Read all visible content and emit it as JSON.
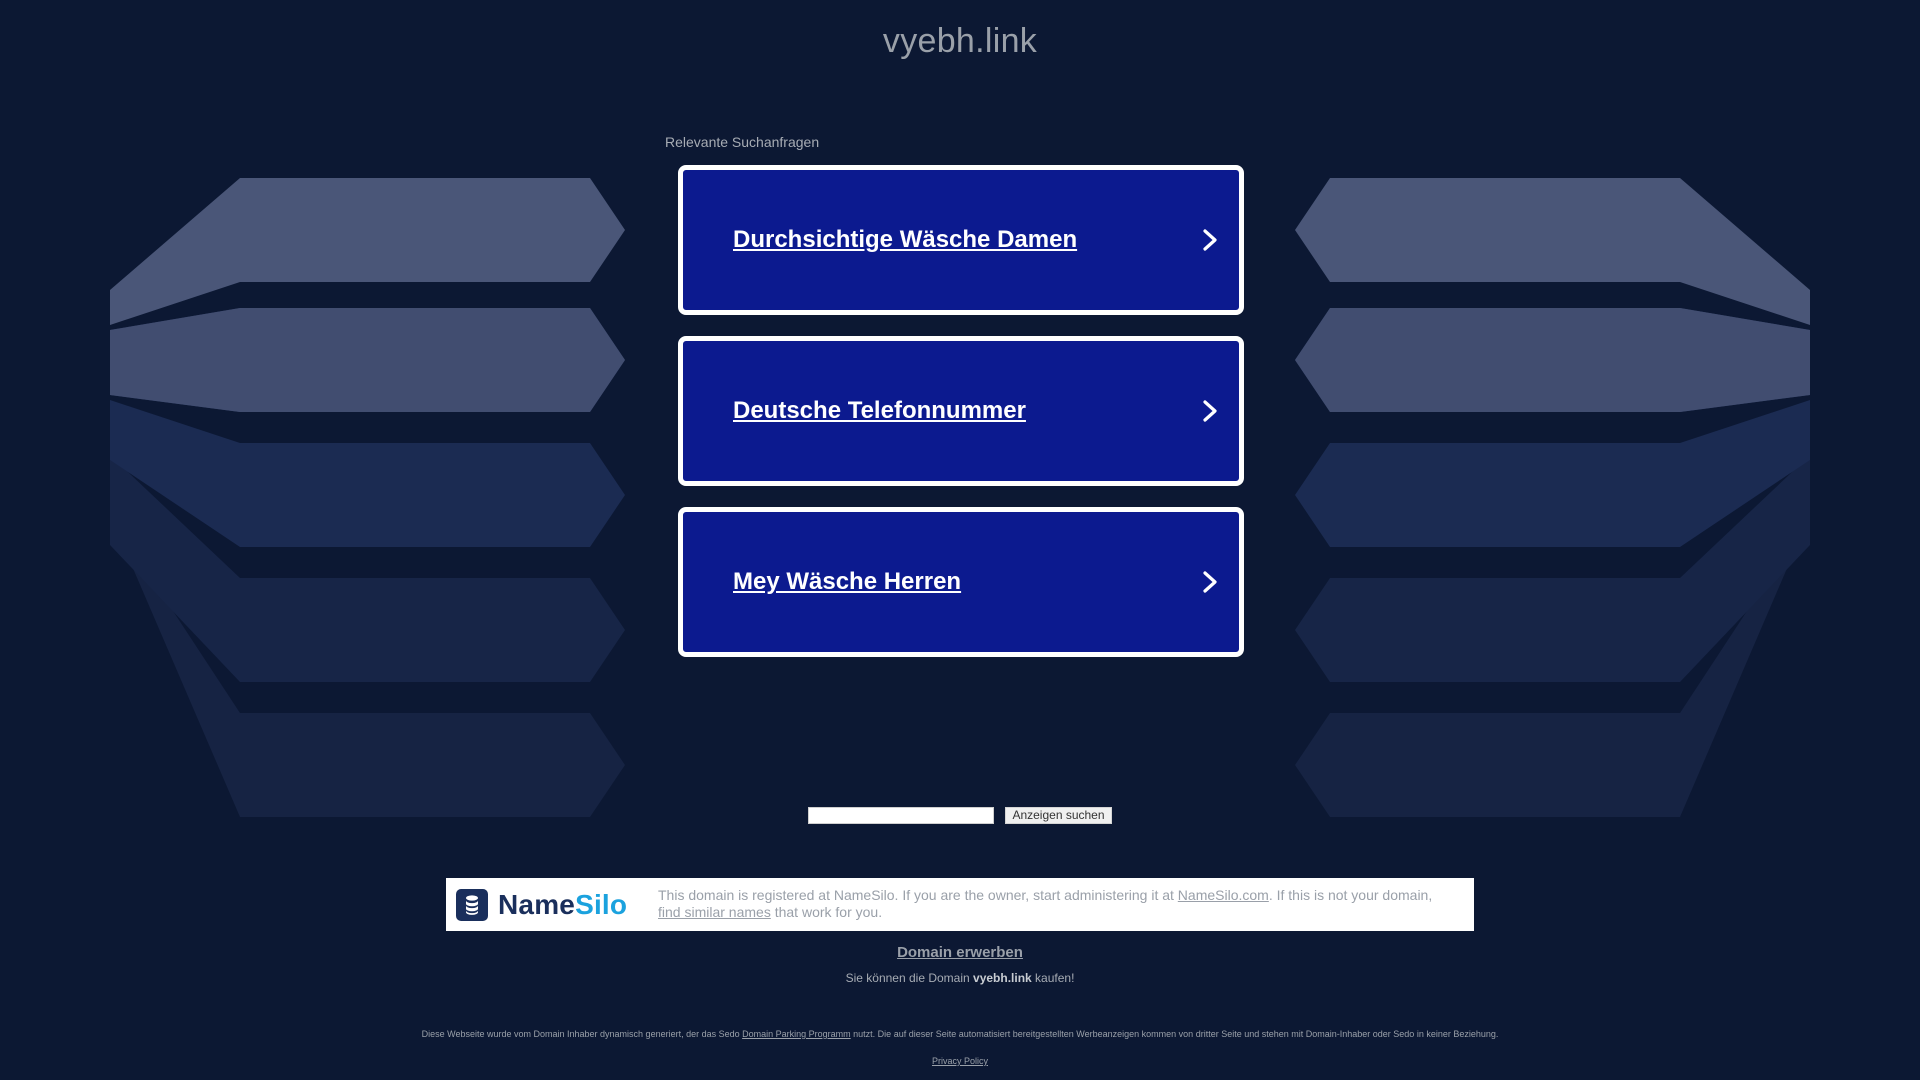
{
  "header": {
    "domain_title": "vyebh.link"
  },
  "related": {
    "label": "Relevante Suchanfragen",
    "items": [
      {
        "label": "Durchsichtige Wäsche Damen"
      },
      {
        "label": "Deutsche Telefonnummer"
      },
      {
        "label": "Mey Wäsche Herren"
      }
    ]
  },
  "search": {
    "input_value": "",
    "button_label": "Anzeigen suchen"
  },
  "registrar": {
    "logo_name": "NameSilo",
    "logo_part1": "Name",
    "logo_part2": "Silo",
    "text_1": "This domain is registered at NameSilo. If you are the owner, start administering it at ",
    "link_namesilo": "NameSilo.com",
    "text_2": ". If this is not your domain, ",
    "link_similar": "find similar names",
    "text_3": " that work for you."
  },
  "buy": {
    "link": "Domain erwerben",
    "text_pre": "Sie können die Domain ",
    "domain": "vyebh.link",
    "text_post": " kaufen!"
  },
  "footer": {
    "disclaimer_1": "Diese Webseite wurde vom Domain Inhaber dynamisch generiert, der das Sedo ",
    "disclaimer_link": "Domain Parking Programm",
    "disclaimer_2": " nutzt. Die auf dieser Seite automatisiert bereitgestellten Werbeanzeigen kommen von dritter Seite und stehen mit Domain-Inhaber oder Sedo in keiner Beziehung.",
    "privacy": "Privacy Policy"
  },
  "colors": {
    "background": "#0c1833",
    "ad_box": "#0c1a8f",
    "namesilo_dark": "#1a2f5c",
    "namesilo_blue": "#1ba2de"
  },
  "icons": {
    "ad_chevron": "chevron-right-icon",
    "namesilo": "database-icon"
  }
}
